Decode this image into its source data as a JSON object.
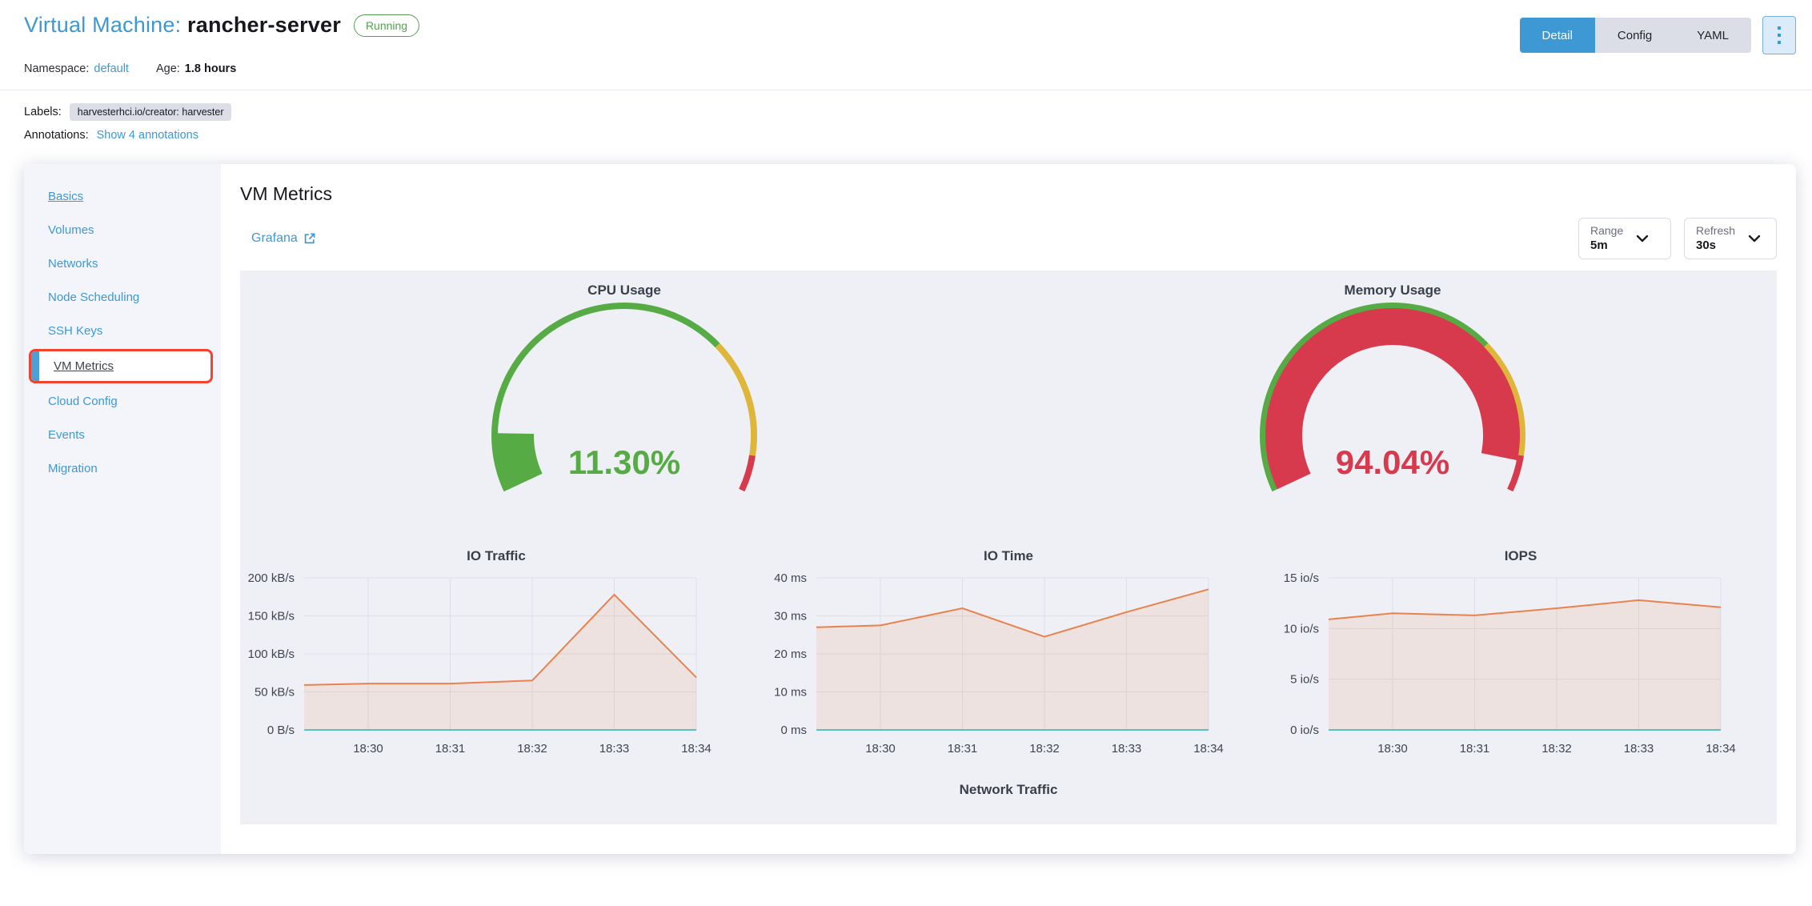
{
  "header": {
    "title_prefix": "Virtual Machine:",
    "vm_name": "rancher-server",
    "status": "Running",
    "namespace_label": "Namespace:",
    "namespace_value": "default",
    "age_label": "Age:",
    "age_value": "1.8 hours",
    "labels_label": "Labels:",
    "label_badge": "harvesterhci.io/creator: harvester",
    "annotations_label": "Annotations:",
    "annotations_link": "Show 4 annotations"
  },
  "tabs": [
    {
      "label": "Detail",
      "active": true
    },
    {
      "label": "Config",
      "active": false
    },
    {
      "label": "YAML",
      "active": false
    }
  ],
  "sidebar": {
    "items": [
      {
        "label": "Basics"
      },
      {
        "label": "Volumes"
      },
      {
        "label": "Networks"
      },
      {
        "label": "Node Scheduling"
      },
      {
        "label": "SSH Keys"
      },
      {
        "label": "VM Metrics",
        "active": true
      },
      {
        "label": "Cloud Config"
      },
      {
        "label": "Events"
      },
      {
        "label": "Migration"
      }
    ]
  },
  "main": {
    "title": "VM Metrics",
    "grafana_label": "Grafana",
    "range_label": "Range",
    "range_value": "5m",
    "refresh_label": "Refresh",
    "refresh_value": "30s"
  },
  "colors": {
    "accent_blue": "#3d98d3",
    "ok_green": "#57ab45",
    "warn_yellow": "#dfb63c",
    "danger_red": "#d63a4c",
    "series_orange": "#e8824e",
    "series_teal": "#57c1c6",
    "panel_bg": "#eef0f5",
    "active_item_border": "#f1432e"
  },
  "chart_data": [
    {
      "type": "gauge",
      "title": "CPU Usage",
      "value": 11.3,
      "display": "11.30%",
      "max": 100,
      "segments": [
        {
          "to": 70,
          "color": "#57ab45"
        },
        {
          "to": 93,
          "color": "#dfb63c"
        },
        {
          "to": 100,
          "color": "#d63a4c"
        }
      ]
    },
    {
      "type": "gauge",
      "title": "Memory Usage",
      "value": 94.04,
      "display": "94.04%",
      "max": 100,
      "segments": [
        {
          "to": 70,
          "color": "#57ab45"
        },
        {
          "to": 93,
          "color": "#dfb63c"
        },
        {
          "to": 100,
          "color": "#d63a4c"
        }
      ]
    },
    {
      "type": "area",
      "title": "IO Traffic",
      "x_ticks": [
        "18:30",
        "18:31",
        "18:32",
        "18:33",
        "18:34"
      ],
      "y_ticks": [
        "0 B/s",
        "50 kB/s",
        "100 kB/s",
        "150 kB/s",
        "200 kB/s"
      ],
      "ymax": 200,
      "series": [
        {
          "color": "#e8824e",
          "fill": "rgba(232,130,78,0.13)",
          "edge_value": 59,
          "values": [
            61,
            61,
            65,
            178,
            69
          ]
        },
        {
          "color": "#57c1c6",
          "edge_value": 0,
          "values": [
            0,
            0,
            0,
            0,
            0
          ]
        }
      ]
    },
    {
      "type": "area",
      "title": "IO Time",
      "x_ticks": [
        "18:30",
        "18:31",
        "18:32",
        "18:33",
        "18:34"
      ],
      "y_ticks": [
        "0 ms",
        "10 ms",
        "20 ms",
        "30 ms",
        "40 ms"
      ],
      "ymax": 40,
      "series": [
        {
          "color": "#e8824e",
          "fill": "rgba(232,130,78,0.13)",
          "edge_value": 27,
          "values": [
            27.5,
            32,
            24.5,
            31,
            37
          ]
        },
        {
          "color": "#57c1c6",
          "edge_value": 0,
          "values": [
            0,
            0,
            0,
            0,
            0
          ]
        }
      ]
    },
    {
      "type": "area",
      "title": "IOPS",
      "x_ticks": [
        "18:30",
        "18:31",
        "18:32",
        "18:33",
        "18:34"
      ],
      "y_ticks": [
        "0 io/s",
        "5 io/s",
        "10 io/s",
        "15 io/s"
      ],
      "ymax": 15,
      "series": [
        {
          "color": "#e8824e",
          "fill": "rgba(232,130,78,0.13)",
          "edge_value": 10.9,
          "values": [
            11.5,
            11.3,
            12,
            12.8,
            12.1
          ]
        },
        {
          "color": "#57c1c6",
          "edge_value": 0,
          "values": [
            0,
            0,
            0,
            0,
            0
          ]
        }
      ]
    },
    {
      "type": "area",
      "title": "Network Traffic",
      "clipped": true
    }
  ]
}
